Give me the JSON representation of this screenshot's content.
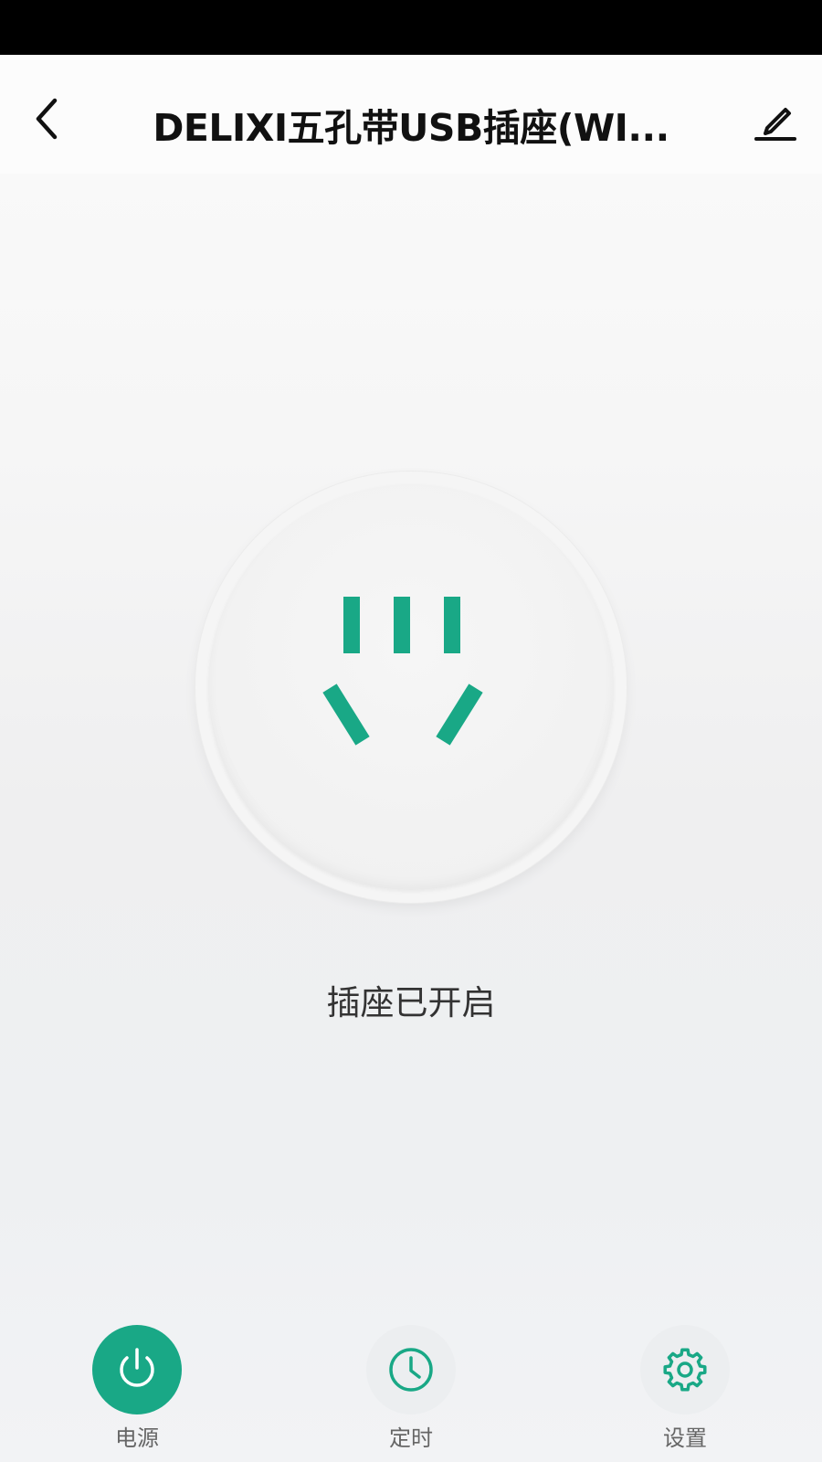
{
  "header": {
    "title": "DELIXI五孔带USB插座(WI..."
  },
  "device": {
    "status_text": "插座已开启",
    "accent_color": "#19a886"
  },
  "tabs": [
    {
      "label": "电源",
      "icon": "power-icon",
      "active": true
    },
    {
      "label": "定时",
      "icon": "clock-icon",
      "active": false
    },
    {
      "label": "设置",
      "icon": "gear-icon",
      "active": false
    }
  ]
}
